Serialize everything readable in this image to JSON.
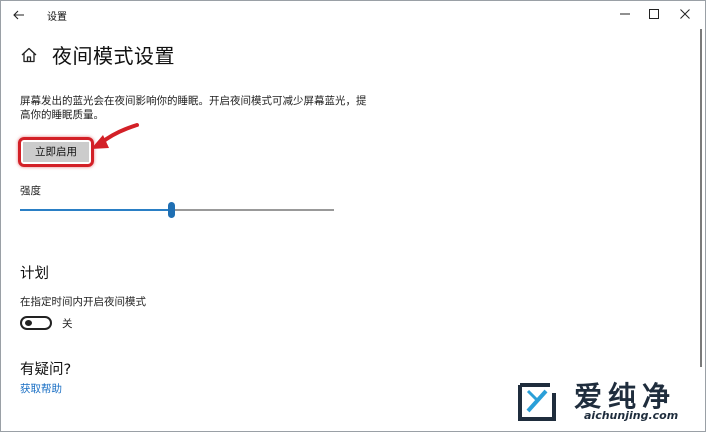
{
  "window": {
    "title": "设置",
    "controls": {
      "back_icon": "back-arrow-icon",
      "minimize_icon": "minimize-icon",
      "maximize_icon": "maximize-icon",
      "close_icon": "close-icon"
    }
  },
  "header": {
    "home_icon": "home-icon",
    "title": "夜间模式设置"
  },
  "main": {
    "description": "屏幕发出的蓝光会在夜间影响你的睡眠。开启夜间模式可减少屏幕蓝光，提高你的睡眠质量。",
    "enable_button": "立即启用",
    "annotation_color": "#d32027",
    "strength": {
      "label": "强度",
      "value_fraction": 0.48,
      "accent": "#1f6fb3"
    },
    "schedule": {
      "heading": "计划",
      "label": "在指定时间内开启夜间模式",
      "toggle_on": false,
      "toggle_state_label": "关"
    },
    "faq": {
      "heading": "有疑问?",
      "link": "获取帮助",
      "link_color": "#1a6fc4"
    }
  },
  "watermark": {
    "brand_cn": "爱纯净",
    "url": "aichunjing.com"
  }
}
